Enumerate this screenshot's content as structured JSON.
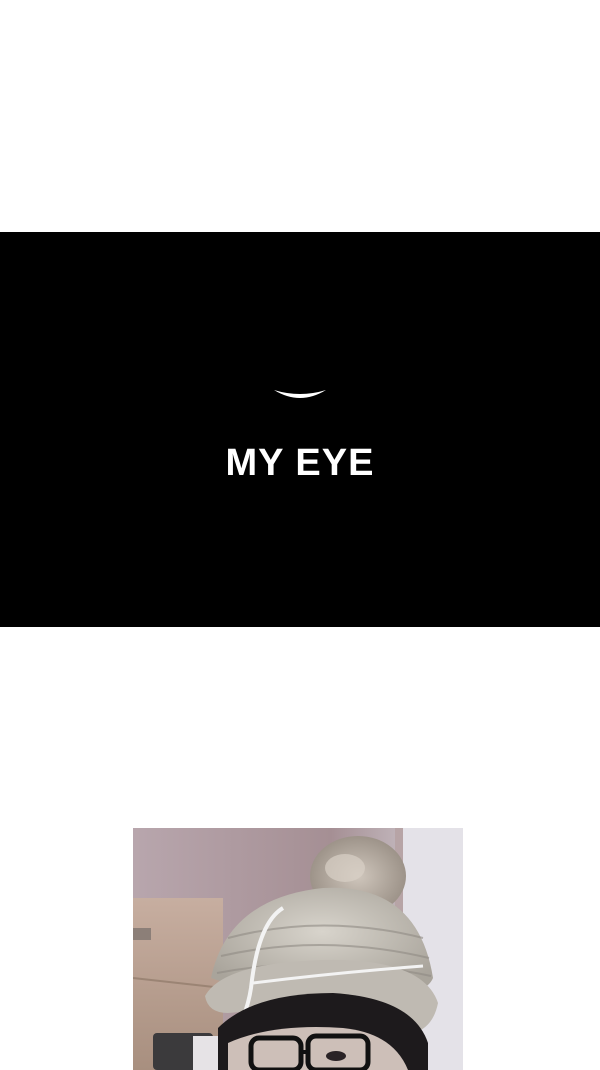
{
  "title_card": {
    "title": "MY EYE",
    "background_color": "#000000",
    "text_color": "#ffffff",
    "mark": "smile-curve-icon"
  },
  "photo": {
    "subject": "self-portrait-photo"
  }
}
